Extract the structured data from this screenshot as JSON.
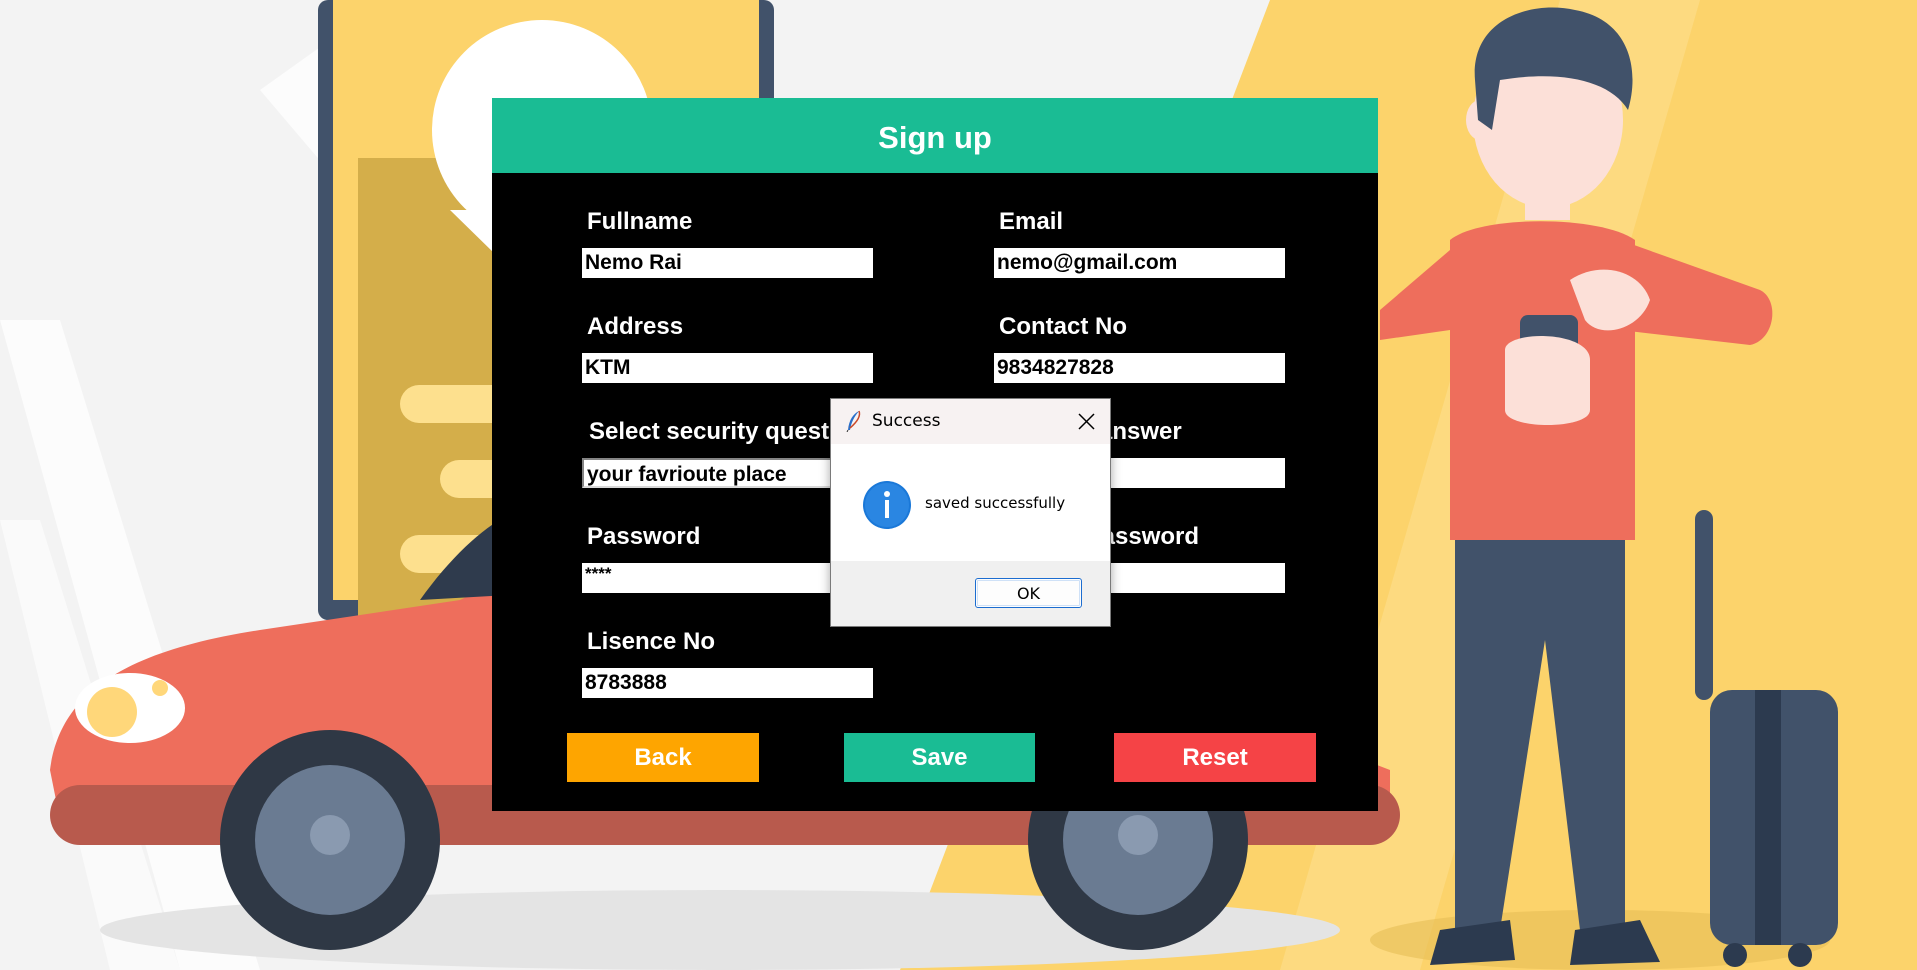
{
  "form": {
    "title": "Sign up",
    "fields": {
      "fullname": {
        "label": "Fullname",
        "value": "Nemo Rai"
      },
      "email": {
        "label": "Email",
        "value": "nemo@gmail.com"
      },
      "address": {
        "label": "Address",
        "value": "KTM"
      },
      "contact": {
        "label": "Contact No",
        "value": "9834827828"
      },
      "security_question": {
        "label": "Select security quest",
        "value": "your favrioute place"
      },
      "security_answer": {
        "label": "answer",
        "value": ""
      },
      "password": {
        "label": "Password",
        "value": "****"
      },
      "confirm_password": {
        "label": "password",
        "value": ""
      },
      "licence": {
        "label": "Lisence No",
        "value": "8783888"
      }
    },
    "buttons": {
      "back": "Back",
      "save": "Save",
      "reset": "Reset"
    },
    "colors": {
      "header": "#1abc94",
      "back": "#fea500",
      "save": "#1abc94",
      "reset": "#f54346"
    }
  },
  "dialog": {
    "title": "Success",
    "message": "saved successfully",
    "ok_label": "OK",
    "icon": "info-icon",
    "title_icon": "feather-icon",
    "close_icon": "close-icon"
  }
}
